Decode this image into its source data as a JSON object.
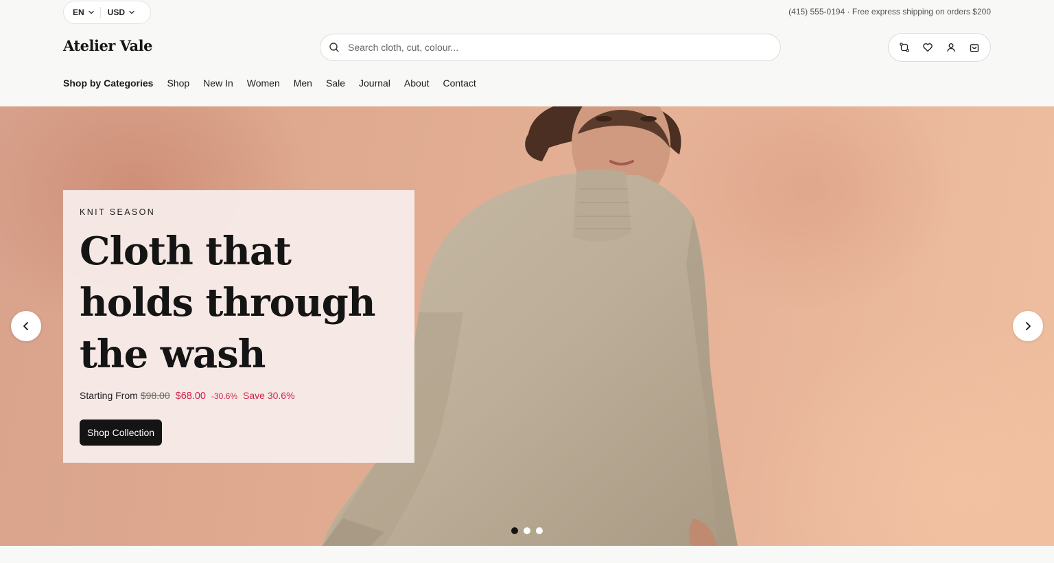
{
  "topbar": {
    "language": "EN",
    "currency": "USD",
    "promo": "(415) 555-0194 · Free express shipping on orders $200"
  },
  "header": {
    "logo": "Atelier Vale",
    "search_placeholder": "Search cloth, cut, colour..."
  },
  "nav": {
    "items": [
      {
        "label": "Shop by Categories"
      },
      {
        "label": "Shop"
      },
      {
        "label": "New In"
      },
      {
        "label": "Women"
      },
      {
        "label": "Men"
      },
      {
        "label": "Sale"
      },
      {
        "label": "Journal"
      },
      {
        "label": "About"
      },
      {
        "label": "Contact"
      }
    ]
  },
  "hero": {
    "eyebrow": "KNIT SEASON",
    "headline": "Cloth that holds through the wash",
    "price_prefix": "Starting From",
    "price_old": "$98.00",
    "price_new": "$68.00",
    "discount_pct": "-30.6%",
    "save_text": "Save 30.6%",
    "cta_label": "Shop Collection",
    "slide_count": 3,
    "active_slide": 1
  },
  "colors": {
    "accent_sale": "#d21e4a",
    "button_bg": "#141414",
    "page_bg": "#f8f8f6"
  },
  "icons": [
    "chevron-down-icon",
    "search-icon",
    "compare-icon",
    "heart-icon",
    "user-icon",
    "cart-icon",
    "chevron-left-icon",
    "chevron-right-icon"
  ]
}
